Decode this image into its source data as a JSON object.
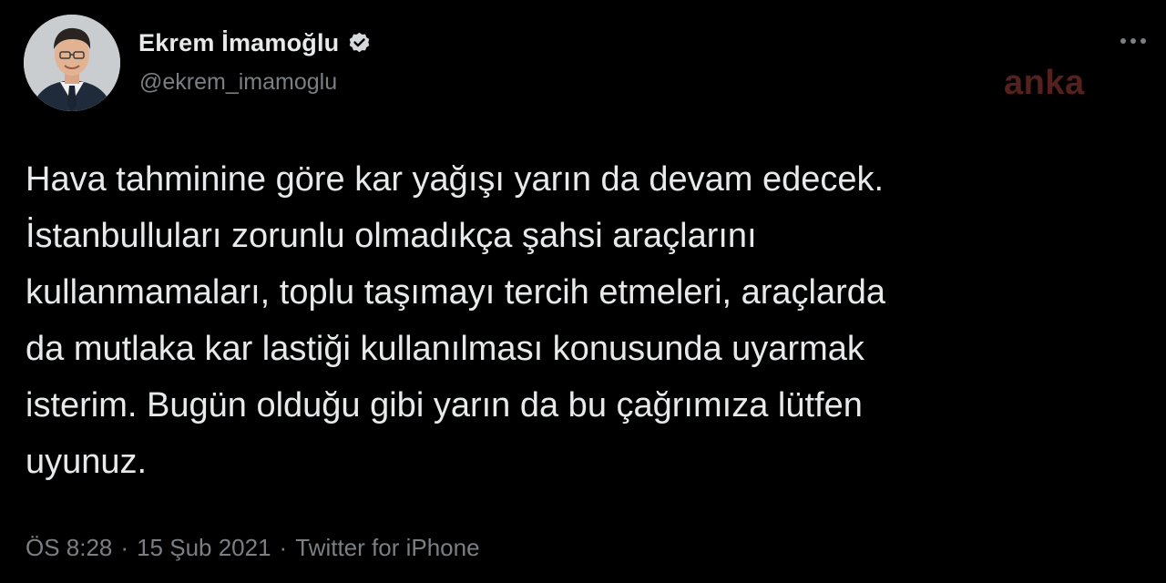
{
  "author": {
    "display_name": "Ekrem İmamoğlu",
    "handle": "@ekrem_imamoglu",
    "verified": true,
    "avatar_icon": "profile-photo"
  },
  "watermark": "anka",
  "tweet": {
    "text": "Hava tahminine göre kar yağışı yarın da devam edecek.\nİstanbulluları zorunlu olmadıkça şahsi araçlarını\nkullanmamaları, toplu taşımayı tercih etmeleri, araçlarda\nda mutlaka kar lastiği kullanılması konusunda uyarmak\nisterim. Bugün olduğu gibi yarın da bu çağrımıza lütfen\nuyunuz."
  },
  "meta": {
    "time": "ÖS 8:28",
    "date": "15 Şub 2021",
    "source": "Twitter for iPhone",
    "separator": "·"
  },
  "colors": {
    "background": "#000000",
    "text": "#e7e9ea",
    "muted": "#7a7f84",
    "watermark": "#6b2a27"
  },
  "icons": {
    "verified": "verified-badge-icon",
    "more": "more-options-icon"
  }
}
